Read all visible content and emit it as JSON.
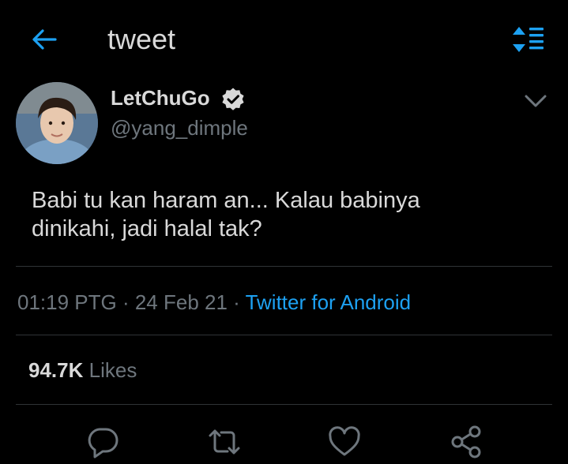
{
  "header": {
    "title": "tweet",
    "back_icon": "arrow-left-icon",
    "sort_icon": "sort-list-icon",
    "accent": "#1da1f2"
  },
  "author": {
    "display_name": "LetChuGo",
    "username": "@yang_dimple",
    "verified": true,
    "avatar": "profile-photo"
  },
  "tweet": {
    "lines": [
      "Babi tu kan haram an... Kalau babinya",
      "dinikahi, jadi halal tak?"
    ]
  },
  "meta": {
    "time": "01:19 PTG",
    "separator": " · ",
    "date": "24 Feb 21",
    "source": "Twitter for Android"
  },
  "stats": {
    "likes_count": "94.7K",
    "likes_label": "Likes"
  },
  "actions": [
    {
      "icon": "reply-icon"
    },
    {
      "icon": "retweet-icon"
    },
    {
      "icon": "like-icon"
    },
    {
      "icon": "share-icon"
    }
  ],
  "colors": {
    "background": "#000000",
    "text": "#d9d9d9",
    "secondary": "#6e767d",
    "link": "#1da1f2",
    "divider": "#2f3336"
  }
}
